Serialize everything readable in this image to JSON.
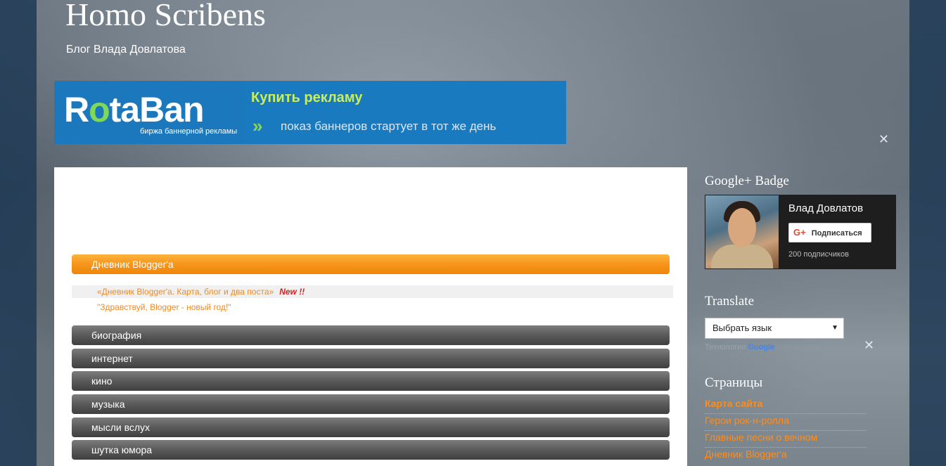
{
  "header": {
    "title": "Homo Scribens",
    "description": "Блог Влада Довлатова"
  },
  "banner": {
    "logo_r": "R",
    "logo_o": "o",
    "logo_rest": "taBan",
    "logo_tagline": "биржа баннерной рекламы",
    "cta": "Купить рекламу",
    "subline": "показ баннеров стартует в тот же день"
  },
  "main": {
    "featured_category": "Дневник Blogger'а",
    "posts": [
      {
        "title": "«Дневник Blogger'а. Карта, блог и два поста»",
        "badge": "New !!"
      },
      {
        "title": "\"Здравствуй, Blogger - новый год!\"",
        "badge": ""
      }
    ],
    "categories": [
      "биография",
      "интернет",
      "кино",
      "музыка",
      "мысли вслух",
      "шутка юмора"
    ]
  },
  "sidebar": {
    "gplus": {
      "title": "Google+ Badge",
      "name": "Влад Довлатов",
      "button": "Подписаться",
      "button_icon": "G+",
      "followers": "200 подписчиков"
    },
    "translate": {
      "title": "Translate",
      "select_value": "Выбрать язык",
      "powered_prefix": "Технологии",
      "powered_brand": "Google",
      "powered_suffix": "Переводчик"
    },
    "pages": {
      "title": "Страницы",
      "items": [
        "Карта сайта",
        "Герои рок-н-ролла",
        "Главные песни о вечном",
        "Дневник Blogger'а"
      ]
    }
  },
  "icons": {
    "tool": "wrench-screwdriver-icon"
  },
  "colors": {
    "accent_orange": "#f7951b",
    "link_orange": "#ff8c1a",
    "banner_blue": "#1a7ac0"
  }
}
